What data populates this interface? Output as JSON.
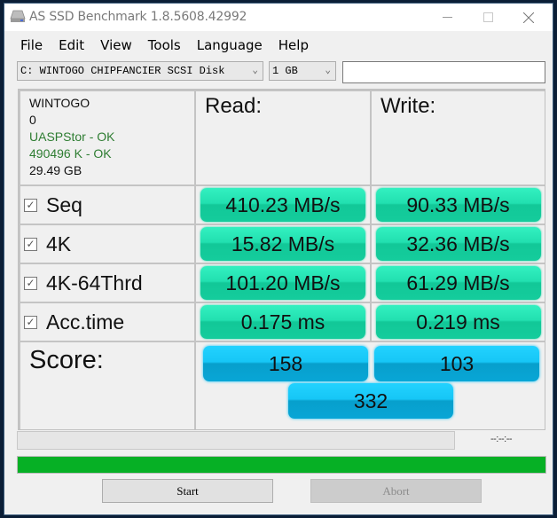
{
  "window": {
    "title": "AS SSD Benchmark 1.8.5608.42992",
    "controls": {
      "minimize": "—",
      "maximize": "☐",
      "close": "✕"
    }
  },
  "menu": [
    "File",
    "Edit",
    "View",
    "Tools",
    "Language",
    "Help"
  ],
  "toolbar": {
    "drive_select": "C: WINTOGO CHIPFANCIER SCSI Disk",
    "size_select": "1 GB",
    "text_input_value": ""
  },
  "drive_info": {
    "name": "WINTOGO",
    "line2": "0",
    "driver_status": "UASPStor - OK",
    "alignment_status": "490496 K - OK",
    "capacity": "29.49 GB"
  },
  "headers": {
    "read": "Read:",
    "write": "Write:"
  },
  "tests": [
    {
      "label": "Seq",
      "checked": true,
      "read": "410.23 MB/s",
      "write": "90.33 MB/s"
    },
    {
      "label": "4K",
      "checked": true,
      "read": "15.82 MB/s",
      "write": "32.36 MB/s"
    },
    {
      "label": "4K-64Thrd",
      "checked": true,
      "read": "101.20 MB/s",
      "write": "61.29 MB/s"
    },
    {
      "label": "Acc.time",
      "checked": true,
      "read": "0.175 ms",
      "write": "0.219 ms"
    }
  ],
  "score": {
    "label": "Score:",
    "read": "158",
    "write": "103",
    "total": "332"
  },
  "progress": {
    "time_readout": "--:--:--",
    "test_progress_percent": 0,
    "overall_progress_percent": 100
  },
  "buttons": {
    "start": "Start",
    "abort": "Abort"
  },
  "colors": {
    "result_box": "#1fd8a8",
    "score_box": "#12bfee",
    "progress_fill": "#06b025"
  }
}
